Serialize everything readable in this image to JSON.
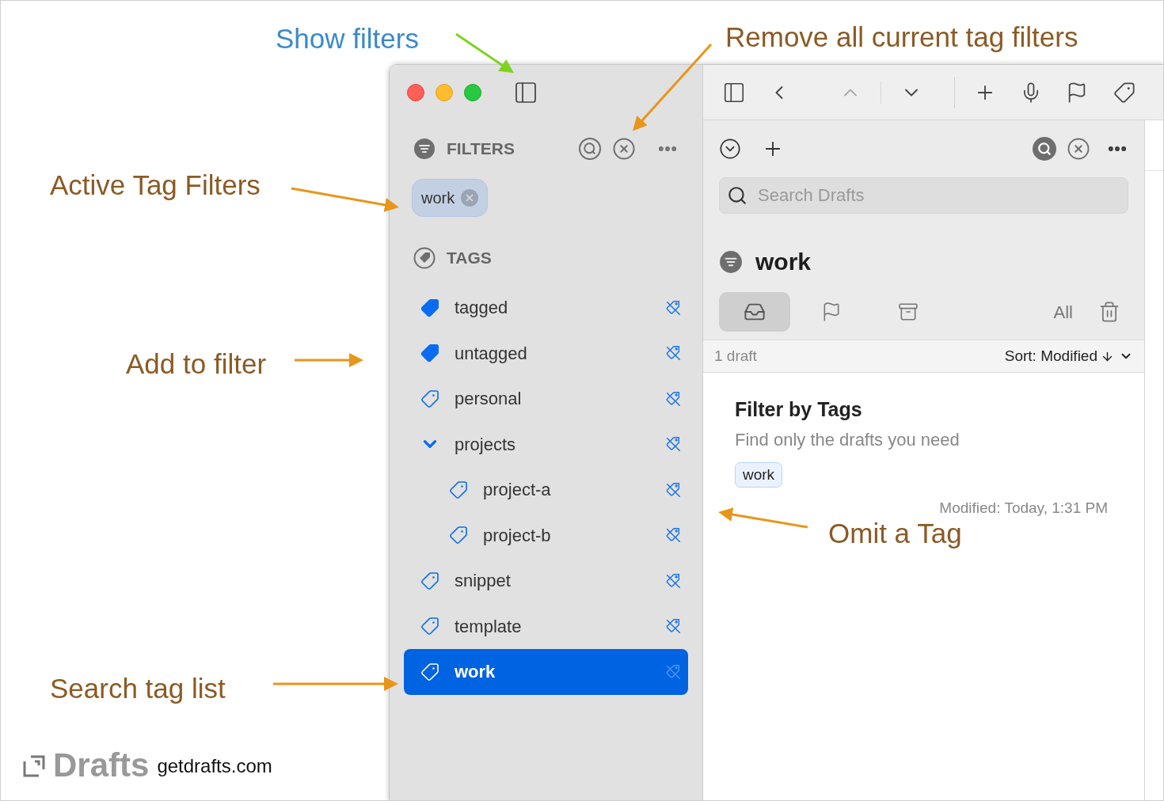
{
  "annotations": [
    {
      "text": "Show filters",
      "color": "#3a8ac8"
    },
    {
      "text": "Remove all current tag filters",
      "color": "#8b5a24"
    },
    {
      "text": "Active Tag Filters",
      "color": "#8b5a24"
    },
    {
      "text": "Add to filter",
      "color": "#8b5a24"
    },
    {
      "text": "Search tag list",
      "color": "#8b5a24"
    },
    {
      "text": "Omit a Tag",
      "color": "#8b5a24"
    }
  ],
  "sidebar": {
    "filters_heading": "FILTERS",
    "active_filters": [
      {
        "label": "work"
      }
    ],
    "tags_heading": "TAGS",
    "tags": [
      {
        "label": "tagged",
        "kind": "smart",
        "selected": false
      },
      {
        "label": "untagged",
        "kind": "smart",
        "selected": false
      },
      {
        "label": "personal",
        "kind": "tag",
        "selected": false
      },
      {
        "label": "projects",
        "kind": "group",
        "expanded": true,
        "selected": false,
        "children": [
          {
            "label": "project-a",
            "kind": "tag",
            "selected": false
          },
          {
            "label": "project-b",
            "kind": "tag",
            "selected": false
          }
        ]
      },
      {
        "label": "snippet",
        "kind": "tag",
        "selected": false
      },
      {
        "label": "template",
        "kind": "tag",
        "selected": false
      },
      {
        "label": "work",
        "kind": "tag",
        "selected": true
      }
    ]
  },
  "draft_list": {
    "search": {
      "placeholder": "Search Drafts"
    },
    "title": "work",
    "segments": [
      {
        "kind": "inbox",
        "selected": true
      },
      {
        "kind": "flagged",
        "selected": false
      },
      {
        "kind": "archive",
        "selected": false
      },
      {
        "kind": "all",
        "label": "All",
        "selected": false
      }
    ],
    "count": "1 draft",
    "sort": "Sort: Modified",
    "drafts": [
      {
        "title": "Filter by Tags",
        "subtitle": "Find only the drafts you need",
        "tags": [
          "work"
        ],
        "modified": "Modified: Today, 1:31 PM"
      }
    ]
  },
  "branding": {
    "name": "Drafts",
    "url": "getdrafts.com"
  }
}
